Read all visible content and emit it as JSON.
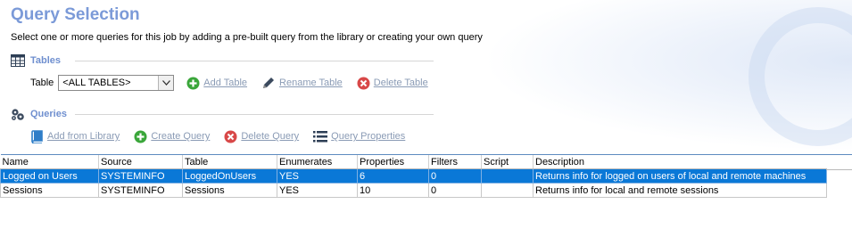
{
  "header": {
    "title": "Query Selection",
    "subtitle": "Select one or more queries for this job by adding a pre-built query from the library or creating your own query"
  },
  "tables_section": {
    "title": "Tables",
    "table_label": "Table",
    "table_select_value": "<ALL TABLES>",
    "add_table": "Add Table",
    "rename_table": "Rename Table",
    "delete_table": "Delete Table"
  },
  "queries_section": {
    "title": "Queries",
    "add_from_library": "Add from Library",
    "create_query": "Create Query",
    "delete_query": "Delete Query",
    "query_properties": "Query Properties"
  },
  "grid": {
    "columns": [
      "Name",
      "Source",
      "Table",
      "Enumerates",
      "Properties",
      "Filters",
      "Script",
      "Description"
    ],
    "rows": [
      [
        "Logged on Users",
        "SYSTEMINFO",
        "LoggedOnUsers",
        "YES",
        "6",
        "0",
        "",
        "Returns info for logged on users of local and remote machines"
      ],
      [
        "Sessions",
        "SYSTEMINFO",
        "Sessions",
        "YES",
        "10",
        "0",
        "",
        "Returns info for local and remote sessions"
      ]
    ],
    "selected_row": 0
  },
  "colors": {
    "title": "#7b9ad8",
    "section": "#6f8fcf",
    "selection": "#0a78d7",
    "add_icon": "#3aa63a",
    "delete_icon": "#d84848"
  }
}
